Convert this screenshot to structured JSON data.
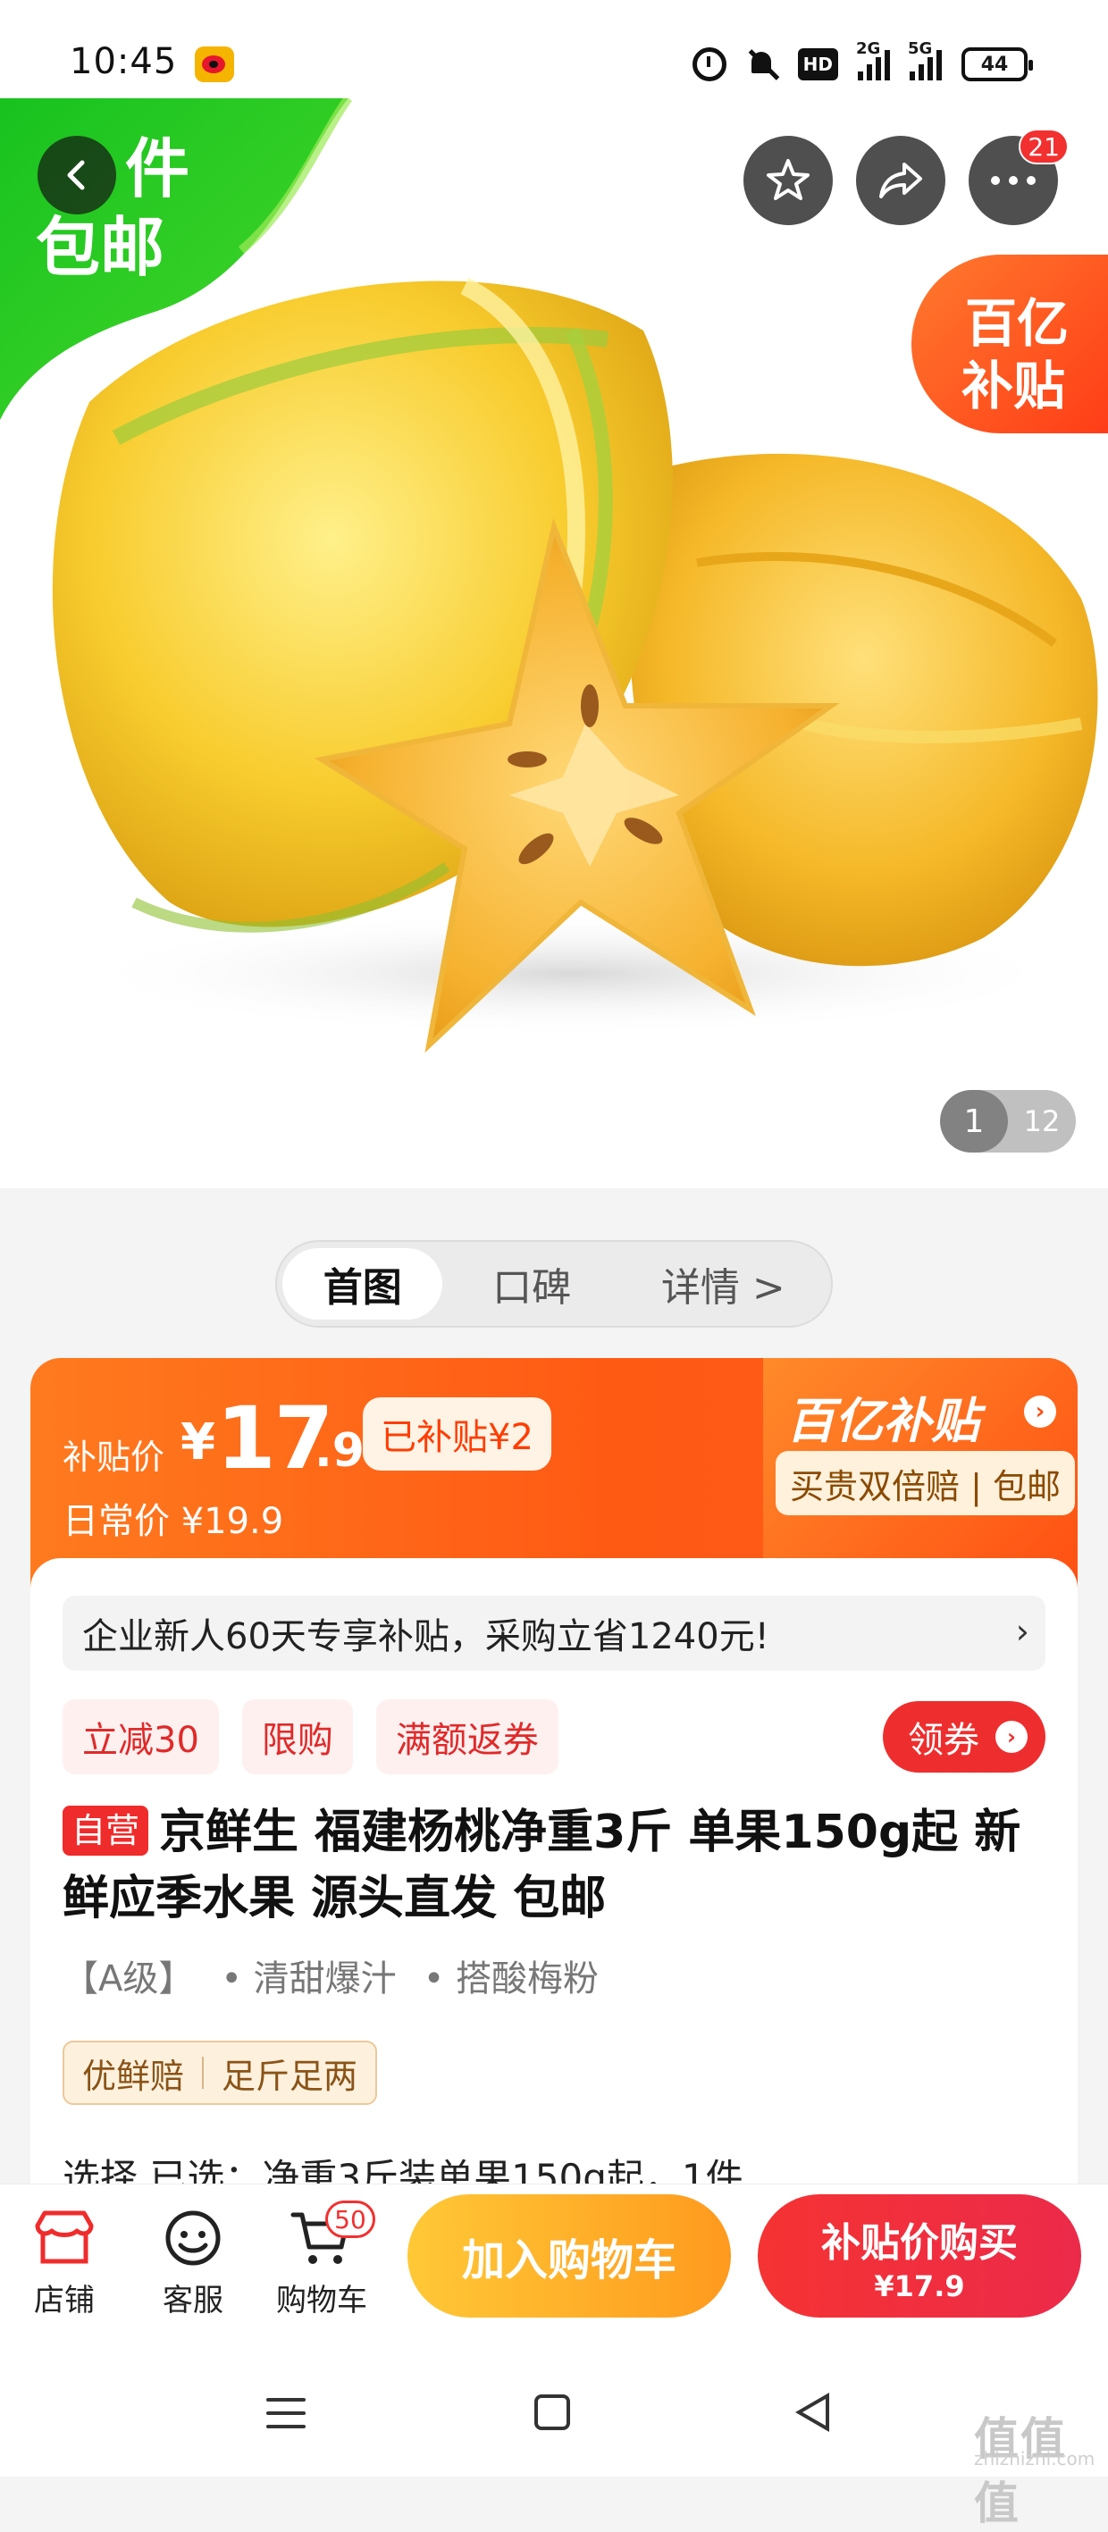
{
  "status_bar": {
    "time": "10:45",
    "hd_label": "HD",
    "sig1_label": "2G",
    "sig2_label": "5G",
    "battery": "44"
  },
  "hero": {
    "badge_line1": "件",
    "badge_line2": "包邮",
    "yi_badge_line1": "百亿",
    "yi_badge_line2": "补贴",
    "more_count": "21",
    "pager_current": "1",
    "pager_total": "12"
  },
  "tabs": [
    {
      "label": "首图"
    },
    {
      "label": "口碑"
    },
    {
      "label": "详情 >"
    }
  ],
  "price": {
    "label": "补贴价",
    "yen": "¥",
    "integer": "17",
    "decimal": ".9",
    "subsidy_tag": "已补贴¥2",
    "daily_label": "日常价 ¥19.9",
    "logo_text": "百亿补贴",
    "logo_arrow": "›",
    "guarantee": "买贵双倍赔 | 包邮"
  },
  "promo": {
    "text": "企业新人60天专享补贴，采购立省1240元!",
    "chevron": "›"
  },
  "tags": [
    "立减30",
    "限购",
    "满额返券"
  ],
  "coupon": {
    "label": "领券",
    "arrow": "›"
  },
  "product": {
    "self_tag": "自营",
    "title": "京鲜生 福建杨桃净重3斤 单果150g起 新鲜应季水果 源头直发 包邮",
    "features": [
      "【A级】",
      "• 清甜爆汁",
      "• 搭酸梅粉"
    ],
    "assure": [
      "优鲜赔",
      "足斤足两"
    ],
    "select_row": "选择    已选：净重3斤装单果150g起，1件"
  },
  "bottom_nav": {
    "shop": "店铺",
    "service": "客服",
    "cart": "购物车",
    "cart_count": "50",
    "add_cart": "加入购物车",
    "buy_line1": "补贴价购买",
    "buy_line2": "¥17.9"
  },
  "watermark": {
    "mark": "值值值",
    "site": "zhizhizhi.com"
  },
  "colors": {
    "accent_orange": "#ff5a14",
    "accent_red": "#f02b2b",
    "badge_green": "#1ec82e"
  }
}
